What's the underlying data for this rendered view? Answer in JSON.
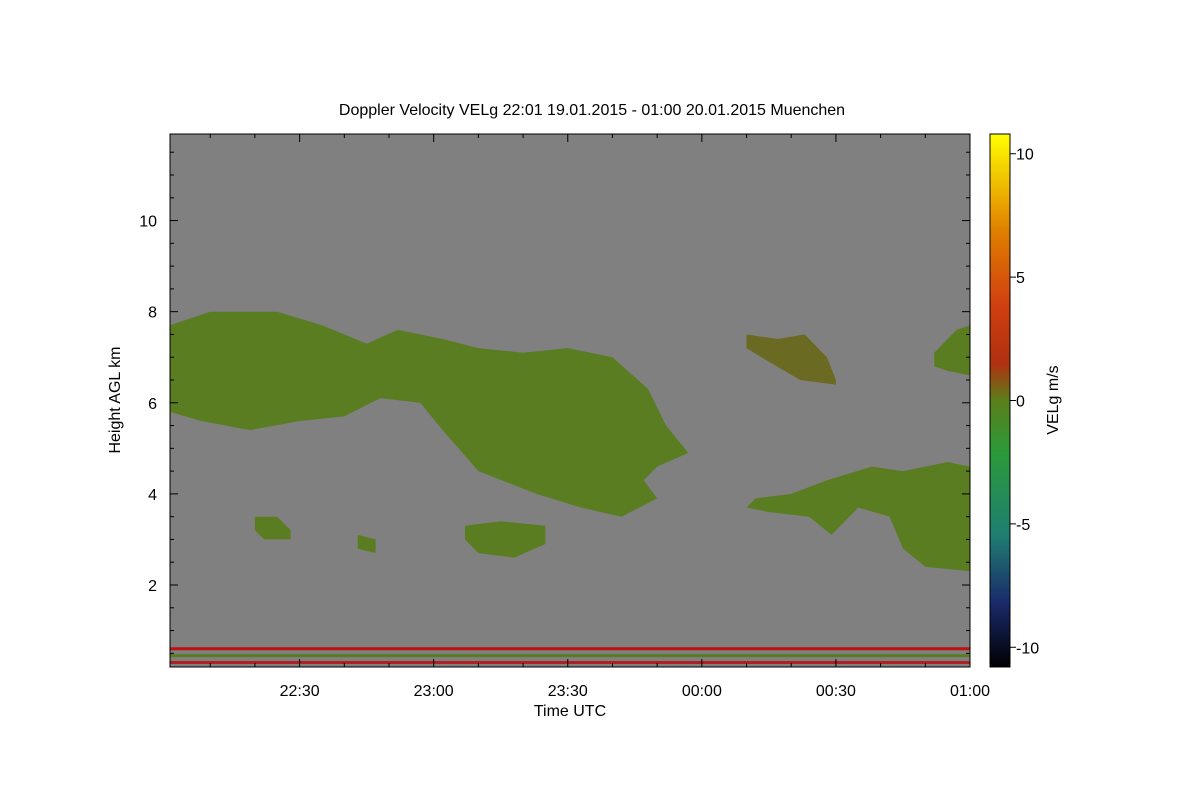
{
  "chart_data": {
    "type": "heatmap",
    "title": "Doppler Velocity VELg   22:01 19.01.2015 - 01:00 20.01.2015 Muenchen",
    "xlabel": "Time UTC",
    "ylabel": "Height AGL km",
    "colorbar_label": "VELg m/s",
    "x_range_minutes_after_midnight": [
      -119,
      60
    ],
    "x_ticks": [
      {
        "value": -90,
        "label": "22:30"
      },
      {
        "value": -60,
        "label": "23:00"
      },
      {
        "value": -30,
        "label": "23:30"
      },
      {
        "value": 0,
        "label": "00:00"
      },
      {
        "value": 30,
        "label": "00:30"
      },
      {
        "value": 60,
        "label": "01:00"
      }
    ],
    "ylim": [
      0.2,
      11.9
    ],
    "y_ticks": [
      {
        "value": 2,
        "label": "2"
      },
      {
        "value": 4,
        "label": "4"
      },
      {
        "value": 6,
        "label": "6"
      },
      {
        "value": 8,
        "label": "8"
      },
      {
        "value": 10,
        "label": "10"
      }
    ],
    "clim": [
      -10.8,
      10.8
    ],
    "colorbar_ticks": [
      {
        "value": 10,
        "label": "10"
      },
      {
        "value": 5,
        "label": "5"
      },
      {
        "value": 0,
        "label": "0"
      },
      {
        "value": -5,
        "label": "-5"
      },
      {
        "value": -10,
        "label": "-10"
      }
    ],
    "background_color": "#808080",
    "colormap": [
      "#000000",
      "#1a2a6a",
      "#1f7f70",
      "#2a9a3a",
      "#5a7f1a",
      "#b03010",
      "#d04010",
      "#e08000",
      "#ffff00"
    ],
    "cloud_layers": [
      {
        "name": "upper",
        "color": "#5a7d22",
        "top": [
          [
            -119,
            7.7
          ],
          [
            -110,
            8.0
          ],
          [
            -95,
            8.0
          ],
          [
            -85,
            7.7
          ],
          [
            -75,
            7.3
          ],
          [
            -68,
            7.6
          ],
          [
            -58,
            7.4
          ],
          [
            -50,
            7.2
          ],
          [
            -40,
            7.1
          ],
          [
            -30,
            7.2
          ],
          [
            -20,
            7.0
          ],
          [
            -12,
            6.3
          ],
          [
            -8,
            5.5
          ],
          [
            -3,
            4.9
          ]
        ],
        "bottom": [
          [
            -3,
            4.9
          ],
          [
            -10,
            4.6
          ],
          [
            -13,
            4.3
          ],
          [
            -10,
            3.9
          ],
          [
            -18,
            3.5
          ],
          [
            -27,
            3.7
          ],
          [
            -37,
            4.0
          ],
          [
            -50,
            4.5
          ],
          [
            -58,
            5.4
          ],
          [
            -63,
            6.0
          ],
          [
            -72,
            6.1
          ],
          [
            -80,
            5.7
          ],
          [
            -90,
            5.6
          ],
          [
            -101,
            5.4
          ],
          [
            -112,
            5.6
          ],
          [
            -119,
            5.8
          ]
        ]
      },
      {
        "name": "right_lower",
        "color": "#5a7d22",
        "top": [
          [
            12,
            3.9
          ],
          [
            20,
            4.0
          ],
          [
            28,
            4.3
          ],
          [
            38,
            4.6
          ],
          [
            45,
            4.5
          ],
          [
            55,
            4.7
          ],
          [
            60,
            4.6
          ]
        ],
        "bottom": [
          [
            60,
            2.3
          ],
          [
            50,
            2.4
          ],
          [
            45,
            2.8
          ],
          [
            42,
            3.5
          ],
          [
            35,
            3.7
          ],
          [
            29,
            3.1
          ],
          [
            24,
            3.5
          ],
          [
            15,
            3.6
          ],
          [
            10,
            3.7
          ]
        ]
      },
      {
        "name": "right_upper",
        "color": "#6a6a22",
        "top": [
          [
            10,
            7.5
          ],
          [
            17,
            7.4
          ],
          [
            23,
            7.5
          ],
          [
            28,
            7.0
          ],
          [
            30,
            6.5
          ]
        ],
        "bottom": [
          [
            30,
            6.4
          ],
          [
            22,
            6.5
          ],
          [
            15,
            6.9
          ],
          [
            10,
            7.2
          ]
        ]
      },
      {
        "name": "far_right_upper",
        "color": "#5a7d22",
        "top": [
          [
            52,
            7.1
          ],
          [
            57,
            7.6
          ],
          [
            60,
            7.7
          ]
        ],
        "bottom": [
          [
            60,
            6.6
          ],
          [
            55,
            6.7
          ],
          [
            52,
            6.8
          ]
        ]
      },
      {
        "name": "mid_low",
        "color": "#5a7d22",
        "top": [
          [
            -53,
            3.3
          ],
          [
            -45,
            3.4
          ],
          [
            -35,
            3.3
          ]
        ],
        "bottom": [
          [
            -35,
            2.9
          ],
          [
            -42,
            2.6
          ],
          [
            -50,
            2.7
          ],
          [
            -53,
            3.0
          ]
        ]
      },
      {
        "name": "small_low_a",
        "color": "#5a7d22",
        "top": [
          [
            -100,
            3.5
          ],
          [
            -95,
            3.5
          ],
          [
            -92,
            3.2
          ]
        ],
        "bottom": [
          [
            -92,
            3.0
          ],
          [
            -98,
            3.0
          ],
          [
            -100,
            3.2
          ]
        ]
      },
      {
        "name": "small_low_b",
        "color": "#5a7d22",
        "top": [
          [
            -77,
            3.1
          ],
          [
            -73,
            3.0
          ]
        ],
        "bottom": [
          [
            -73,
            2.7
          ],
          [
            -77,
            2.8
          ]
        ]
      }
    ],
    "near_surface_lines": [
      {
        "height": 0.6,
        "color": "#c01010"
      },
      {
        "height": 0.45,
        "color": "#5a7d22"
      },
      {
        "height": 0.3,
        "color": "#b02020"
      }
    ]
  }
}
